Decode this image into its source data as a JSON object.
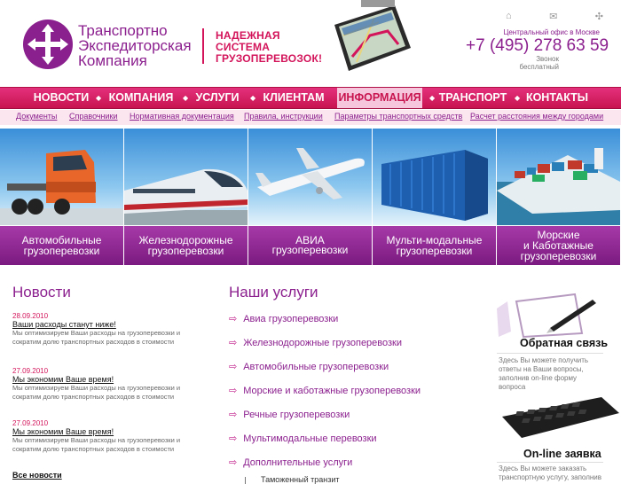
{
  "header": {
    "company_name": "Транспортно\nЭкспедиторская\nКомпания",
    "slogan": "НАДЕЖНАЯ\nСИСТЕМА\nГРУЗОПЕРЕВОЗОК!",
    "office_label": "Центральный офис в Москве",
    "phone": "+7 (495) 278 63 59",
    "free_call": "Звонок бесплатный",
    "icons": [
      "home-icon",
      "mail-icon",
      "sitemap-icon"
    ]
  },
  "nav": {
    "items": [
      "НОВОСТИ",
      "КОМПАНИЯ",
      "УСЛУГИ",
      "КЛИЕНТАМ",
      "ИНФОРМАЦИЯ",
      "ТРАНСПОРТ",
      "КОНТАКТЫ"
    ],
    "active": "ИНФОРМАЦИЯ"
  },
  "subnav": {
    "items": [
      "Документы",
      "Справочники",
      "Нормативная документация",
      "Правила, инструкции",
      "Параметры транспортных средств",
      "Расчет расстояния между городами"
    ]
  },
  "banners": [
    {
      "caption": "Автомобильные\nгрузоперевозки",
      "icon": "truck"
    },
    {
      "caption": "Железнодорожные\nгрузоперевозки",
      "icon": "train"
    },
    {
      "caption": "АВИА\nгрузоперевозки",
      "icon": "airplane"
    },
    {
      "caption": "Мульти-модальные\nгрузоперевозки",
      "icon": "container"
    },
    {
      "caption": "Морские\nи Каботажные\nгрузоперевозки",
      "icon": "ship"
    }
  ],
  "news": {
    "title": "Новости",
    "items": [
      {
        "date": "28.09.2010",
        "headline": "Ваши расходы станут ниже!",
        "body": "Мы оптимизируем Ваши расходы на грузоперевозки и сократим долю транспортных расходов в стоимости"
      },
      {
        "date": "27.09.2010",
        "headline": "Мы экономим Ваше время!",
        "body": "Мы оптимизируем Ваши расходы на грузоперевозки и сократим долю транспортных расходов в стоимости"
      },
      {
        "date": "27.09.2010",
        "headline": "Мы экономим Ваше время!",
        "body": "Мы оптимизируем Ваши расходы на грузоперевозки и сократим долю транспортных расходов в стоимости"
      }
    ],
    "all_link": "Все новости"
  },
  "services": {
    "title": "Наши услуги",
    "items": [
      "Авиа грузоперевозки",
      "Железнодорожные грузоперевозки",
      "Автомобильные грузоперевозки",
      "Морские и каботажные грузоперевозки",
      "Речные грузоперевозки",
      "Мультимодальные перевозки",
      "Дополнительные услуги"
    ],
    "sub_item": "Таможенный транзит"
  },
  "feedback": {
    "title": "Обратная связь",
    "desc": "Здесь Вы можете получить ответы на Ваши вопросы, заполнив on-line форму вопроса"
  },
  "online_order": {
    "title": "On-line заявка",
    "desc": "Здесь Вы можете заказать транспортную услугу, заполнив"
  },
  "colors": {
    "brand_purple": "#8b1f8e",
    "brand_pink": "#d3145a",
    "nav_active_bg": "#f6c7dc"
  }
}
